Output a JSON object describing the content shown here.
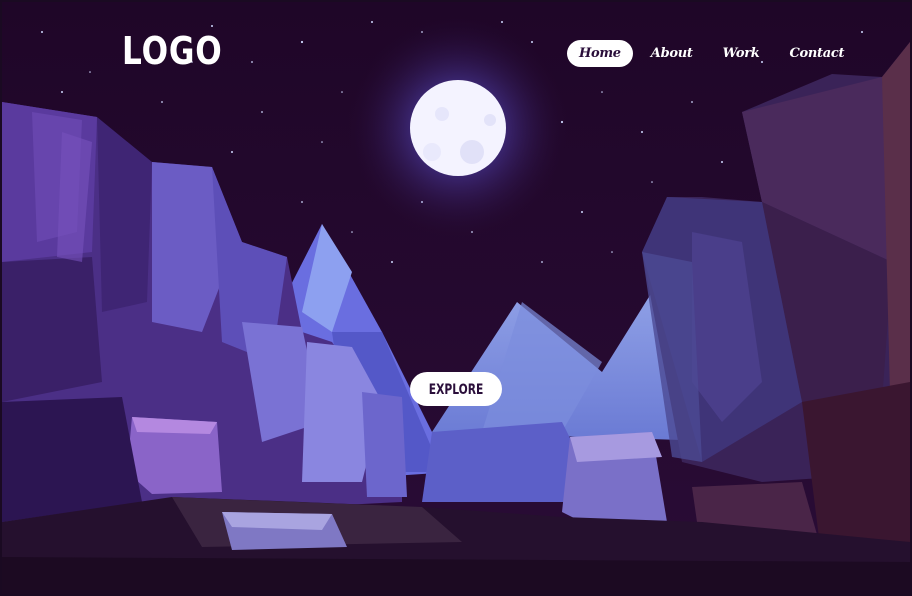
{
  "header": {
    "logo_text": "LOGO"
  },
  "nav": {
    "items": [
      {
        "label": "Home",
        "active": true
      },
      {
        "label": "About",
        "active": false
      },
      {
        "label": "Work",
        "active": false
      },
      {
        "label": "Contact",
        "active": false
      }
    ]
  },
  "hero": {
    "cta_label": "EXPLORE"
  },
  "colors": {
    "sky": "#22082a",
    "moon": "#f4f3ff",
    "moon_glow": "#7a6cff",
    "mountain_light": "#7f8ee0",
    "mountain_mid": "#6a73d8",
    "rock_purple": "#5b3d9e",
    "rock_dark": "#2e1848",
    "ground": "#1e0d28"
  },
  "icons": {
    "moon": "moon-icon",
    "stars": "star-icon"
  }
}
